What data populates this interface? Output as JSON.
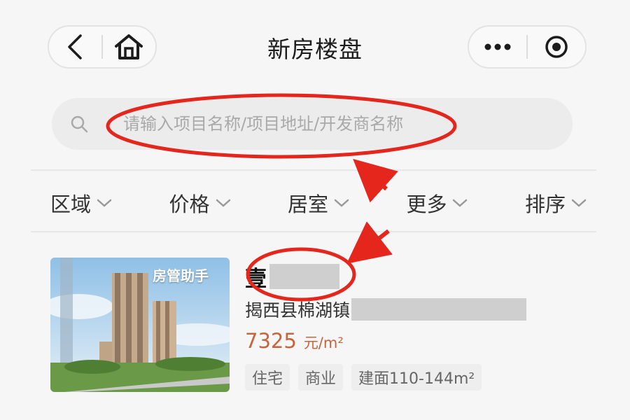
{
  "header": {
    "title": "新房楼盘",
    "left_icons": [
      "back-chevron-icon",
      "home-icon"
    ],
    "right_icons": [
      "more-dots-icon",
      "target-circle-icon"
    ]
  },
  "search": {
    "placeholder": "请输入项目名称/项目地址/开发商名称",
    "icon": "search-icon"
  },
  "filters": [
    {
      "label": "区域"
    },
    {
      "label": "价格"
    },
    {
      "label": "居室"
    },
    {
      "label": "更多"
    },
    {
      "label": "排序"
    }
  ],
  "listing": {
    "watermark": "房管助手",
    "name": "壹",
    "address": "揭西县棉湖镇",
    "price": "7325",
    "price_unit": "元/m²",
    "tags": [
      "住宅",
      "商业",
      "建面110-144m²"
    ]
  },
  "colors": {
    "accent_price": "#c8643d",
    "annotation_red": "#e4261c"
  }
}
